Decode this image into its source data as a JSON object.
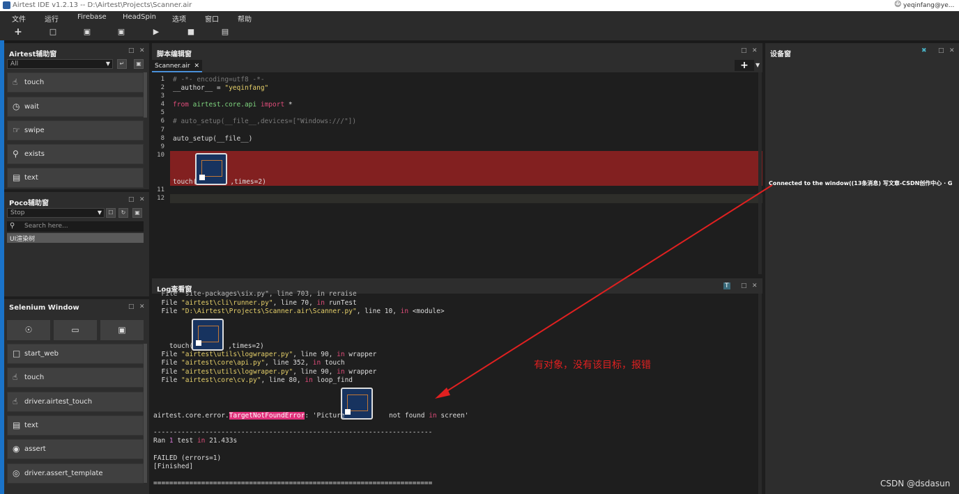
{
  "window": {
    "title": "Airtest IDE v1.2.13 -- D:\\Airtest\\Projects\\Scanner.air",
    "user": "yeqinfang@ye..."
  },
  "menu": [
    "文件",
    "运行",
    "Firebase",
    "HeadSpin",
    "选项",
    "窗口",
    "帮助"
  ],
  "airtest_panel": {
    "title": "Airtest辅助窗",
    "filter": "All",
    "items": [
      "touch",
      "wait",
      "swipe",
      "exists",
      "text"
    ]
  },
  "poco_panel": {
    "title": "Poco辅助窗",
    "mode": "Stop",
    "search_placeholder": "Search here...",
    "tree_item": "UI渲染树"
  },
  "selenium_panel": {
    "title": "Selenium Window",
    "items": [
      "start_web",
      "touch",
      "driver.airtest_touch",
      "text",
      "assert",
      "driver.assert_template"
    ]
  },
  "editor": {
    "title": "脚本编辑窗",
    "tab": "Scanner.air",
    "line_numbers": [
      "1",
      "2",
      "3",
      "4",
      "5",
      "6",
      "7",
      "8",
      "9",
      "10",
      "11",
      "12"
    ],
    "lines": {
      "l1": "# -*- encoding=utf8 -*-",
      "l2a": "__author__ = ",
      "l2b": "\"yeqinfang\"",
      "l4a": "from",
      "l4b": " airtest.core.api ",
      "l4c": "import",
      "l4d": " *",
      "l6": "# auto_setup(__file__,devices=[\"Windows:///\"])",
      "l8": "auto_setup(__file__)",
      "l10a": "touch(",
      "l10b": ",times=2)"
    }
  },
  "log": {
    "title": "Log查看窗",
    "lines": {
      "a": "  File \"site-packages\\six.py\", line 703, in reraise",
      "b1": "  File ",
      "b2": "\"airtest\\cli\\runner.py\"",
      "b3": ", line 70, ",
      "b4": "in",
      "b5": " runTest",
      "c1": "  File ",
      "c2": "\"D:\\Airtest\\Projects\\Scanner.air\\Scanner.py\"",
      "c3": ", line 10, ",
      "c4": "in",
      "c5": " <module>",
      "d1": "    touch(",
      "d2": ",times=2)",
      "e1": "  File ",
      "e2": "\"airtest\\utils\\logwraper.py\"",
      "e3": ", line 90, ",
      "e4": "in",
      "e5": " wrapper",
      "f1": "  File ",
      "f2": "\"airtest\\core\\api.py\"",
      "f3": ", line 352, ",
      "f4": "in",
      "f5": " touch",
      "g1": "  File ",
      "g2": "\"airtest\\utils\\logwraper.py\"",
      "g3": ", line 90, ",
      "g4": "in",
      "g5": " wrapper",
      "h1": "  File ",
      "h2": "\"airtest\\core\\cv.py\"",
      "h3": ", line 80, ",
      "h4": "in",
      "h5": " loop_find",
      "i1": "airtest.core.error.",
      "i2": "TargetNotFoundError",
      "i3": ": 'Picture ",
      "i4": " not found ",
      "i5": "in",
      "i6": " screen'",
      "dash": "----------------------------------------------------------------------",
      "j1": "Ran ",
      "j2": "1",
      "j3": " test ",
      "j4": "in",
      "j5": " 21.433s",
      "k": "FAILED (errors=1)",
      "l": "[Finished]",
      "eq": "======================================================================"
    }
  },
  "device_panel": {
    "title": "设备窗",
    "connected_text": "Connected to the window((13条消息) 写文章-CSDN创作中心 · G"
  },
  "annotation": {
    "text": "有对象，没有该目标，报错",
    "color": "#e02020"
  },
  "watermark": "CSDN @dsdasun"
}
